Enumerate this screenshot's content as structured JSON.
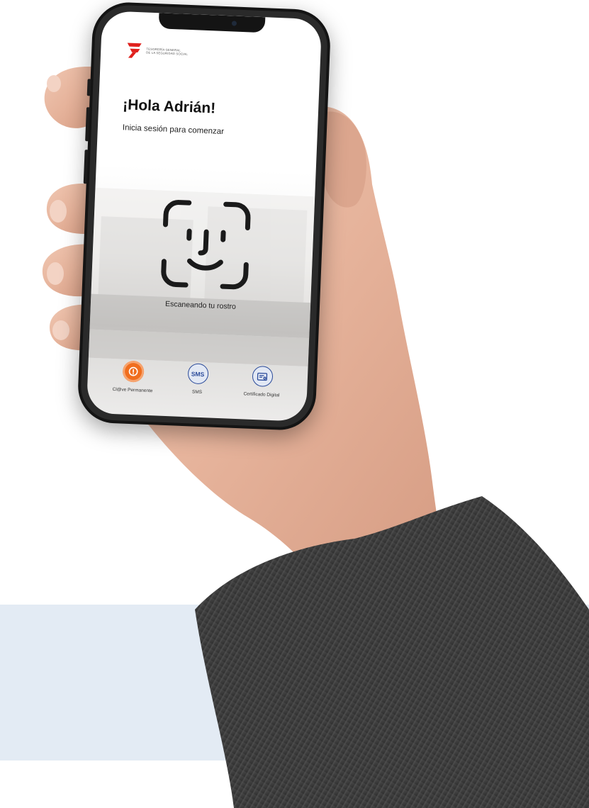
{
  "logo": {
    "line1": "Tesorería General",
    "line2": "de la Seguridad Social"
  },
  "greeting": "¡Hola Adrián!",
  "subtitle": "Inicia sesión para comenzar",
  "scan_label": "Escaneando tu rostro",
  "methods": [
    {
      "label": "Cl@ve Permanente",
      "icon": "clave-icon"
    },
    {
      "label": "SMS",
      "icon": "sms-icon",
      "icon_text": "SMS"
    },
    {
      "label": "Certificado Digital",
      "icon": "certificate-icon"
    }
  ],
  "colors": {
    "brand_red": "#e0211d",
    "accent_orange": "#f06e1e",
    "accent_blue": "#2a4a9a",
    "band": "#e3ebf4"
  }
}
